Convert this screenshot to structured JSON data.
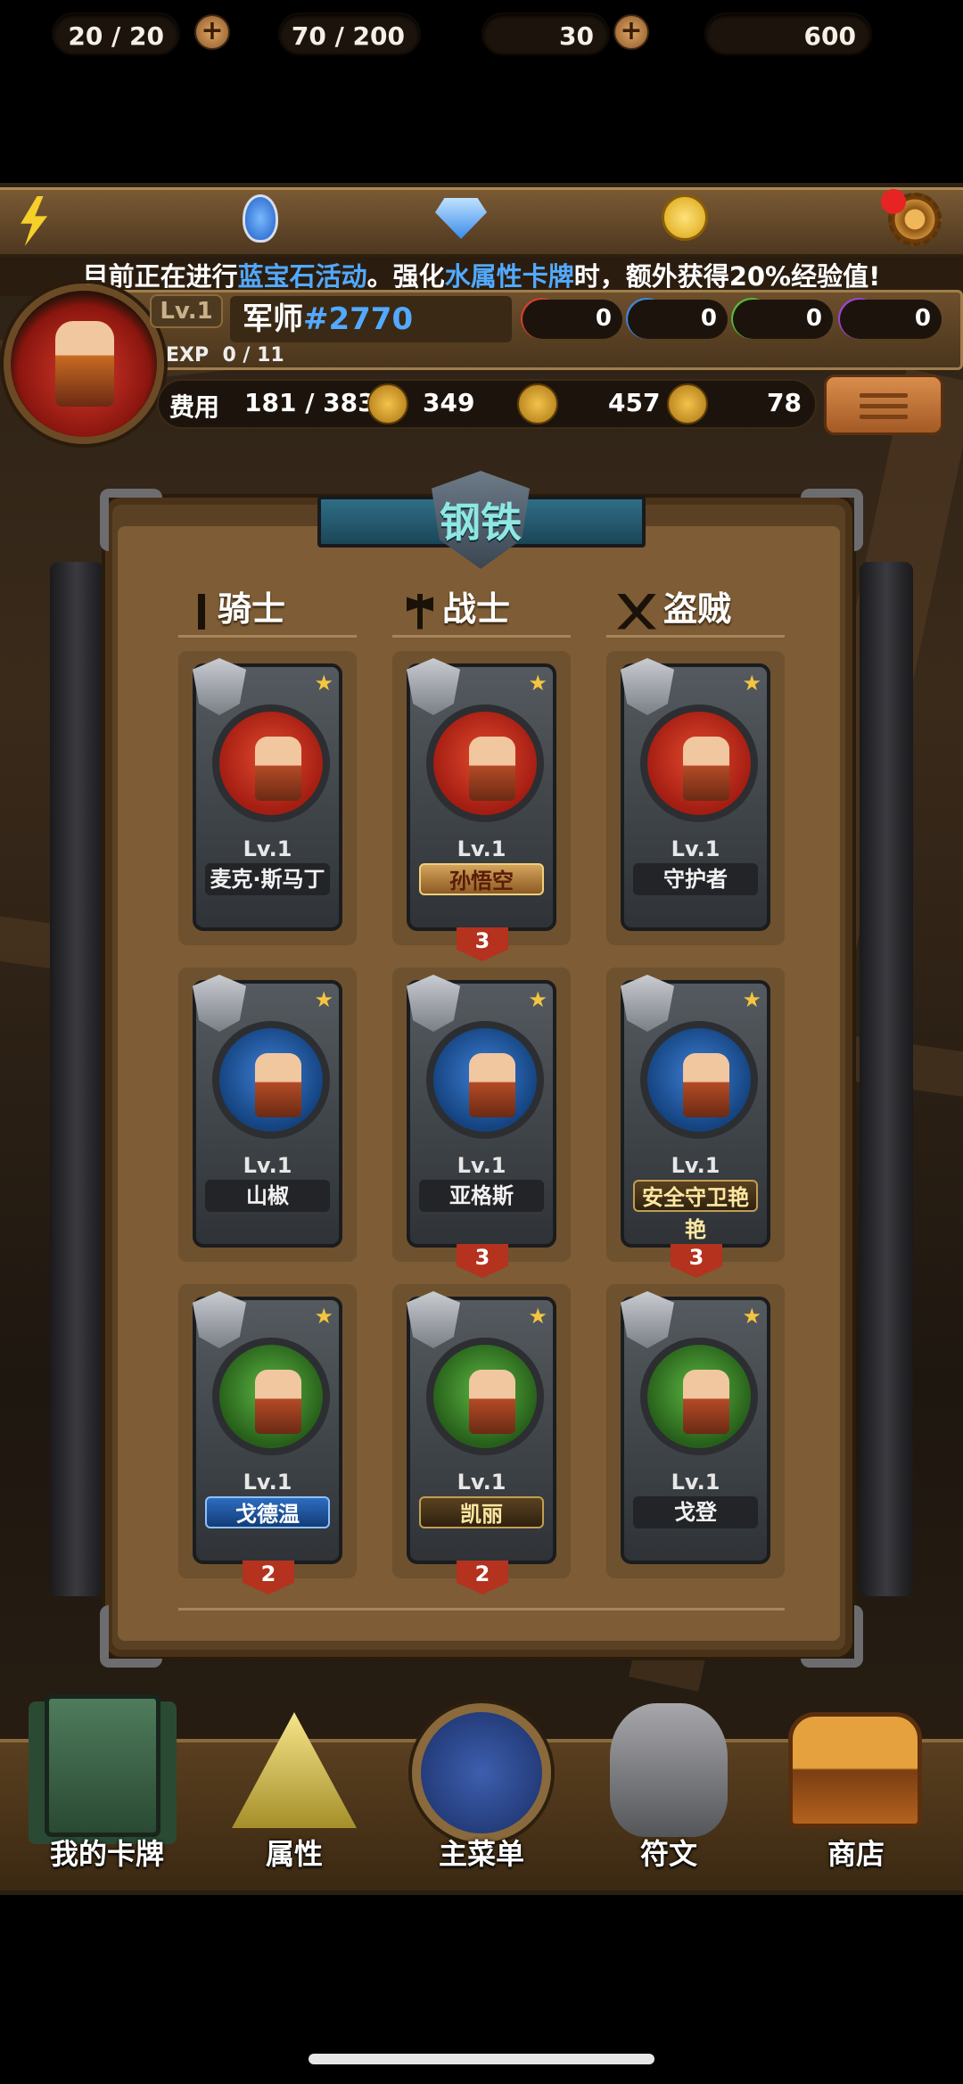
{
  "resources": {
    "energy": "20 / 20",
    "potion": "70 / 200",
    "gems": "30",
    "coins": "600"
  },
  "notice": {
    "pre": "目前正在进行",
    "event": "蓝宝石活动",
    "mid": "。强化",
    "attr": "水属性卡牌",
    "post": "时，额外获得20%经验值!"
  },
  "profile": {
    "level": "Lv.1",
    "name_prefix": "军师",
    "name_id": "#2770",
    "exp_label": "EXP",
    "exp_value": "0 / 11"
  },
  "elements": {
    "fire": "0",
    "water": "0",
    "wood": "0",
    "dark": "0"
  },
  "stats": {
    "cost_label": "费用",
    "cost": "181 / 383",
    "attack": "349",
    "hp": "457",
    "heal": "78"
  },
  "panel": {
    "title": "钢铁",
    "columns": [
      "骑士",
      "战士",
      "盗贼"
    ]
  },
  "cards": [
    {
      "level": "Lv.1",
      "name": "麦克·斯马丁",
      "element": "fire",
      "count": ""
    },
    {
      "level": "Lv.1",
      "name": "孙悟空",
      "element": "fire",
      "count": "3"
    },
    {
      "level": "Lv.1",
      "name": "守护者",
      "element": "fire",
      "count": ""
    },
    {
      "level": "Lv.1",
      "name": "山椒",
      "element": "water",
      "count": ""
    },
    {
      "level": "Lv.1",
      "name": "亚格斯",
      "element": "water",
      "count": "3"
    },
    {
      "level": "Lv.1",
      "name": "安全守卫艳艳",
      "element": "water",
      "count": "3"
    },
    {
      "level": "Lv.1",
      "name": "戈德温",
      "element": "wood",
      "count": "2"
    },
    {
      "level": "Lv.1",
      "name": "凯丽",
      "element": "wood",
      "count": "2"
    },
    {
      "level": "Lv.1",
      "name": "戈登",
      "element": "wood",
      "count": ""
    }
  ],
  "nav": [
    "我的卡牌",
    "属性",
    "主菜单",
    "符文",
    "商店"
  ],
  "colors": {
    "accent_blue": "#52a9ff",
    "gold": "#f3c540",
    "panel": "#7d5c36"
  }
}
